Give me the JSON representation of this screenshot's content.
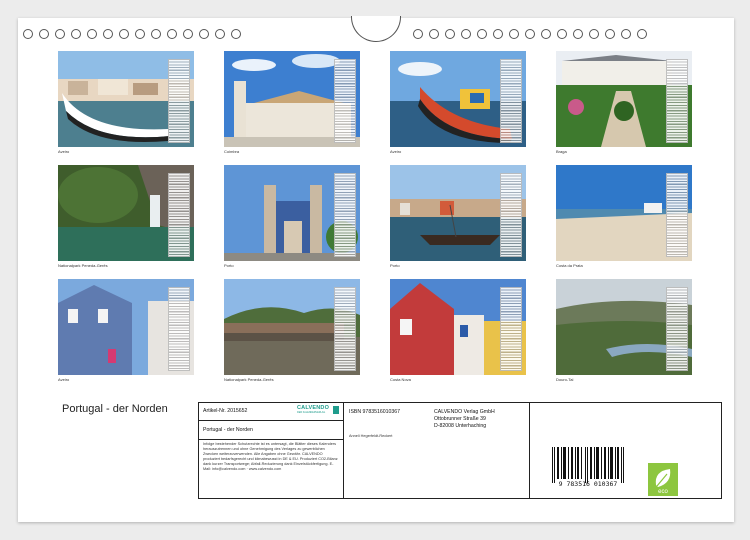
{
  "photos": [
    {
      "caption": "Aveiro"
    },
    {
      "caption": "Coimbra"
    },
    {
      "caption": "Aveiro"
    },
    {
      "caption": "Braga"
    },
    {
      "caption": "Nationalpark Peneda-Gerês"
    },
    {
      "caption": "Porto"
    },
    {
      "caption": "Porto"
    },
    {
      "caption": "Costa da Prata"
    },
    {
      "caption": "Aveiro"
    },
    {
      "caption": "Nationalpark Peneda-Gerês"
    },
    {
      "caption": "Costa Nova"
    },
    {
      "caption": "Douro-Tal"
    }
  ],
  "title": "Portugal - der Norden",
  "info": {
    "article": "Artikel-Nr. 2015652",
    "product_title": "Portugal - der Norden",
    "legal_text": "Infolge bestehender Schutzrechte ist es untersagt, die Blätter dieses Kalenders herauszutrennen und ohne Genehmigung des Verlages zu gewerblichen Zwecken weiterzuverwenden. Alle Angaben ohne Gewähr. CALVENDO produziert bedarfsgerecht und klimabewusst in DE & EU. Produziert CO2-Bilanz dank kurzer Transportwege; Abfall-Reduzierung dank Einzelstückfertigung. E-Mail: info@calvendo.com · www.calvendo.com",
    "isbn": "ISBN 9783516010367",
    "publisher_name": "CALVENDO Verlag GmbH",
    "publisher_street": "Ottobrunner Straße 39",
    "publisher_city": "D-82008 Unterhaching",
    "author": "Anneli Hegerfeldt-Reckert",
    "barcode_number": "9 783516 010367",
    "logo_text": "CALVENDO",
    "logo_sub": "DER KALENDERVERLAG",
    "eco_label": "eco"
  },
  "colors": {
    "eco_green": "#8dc63f",
    "logo_teal": "#1f9c8c"
  }
}
